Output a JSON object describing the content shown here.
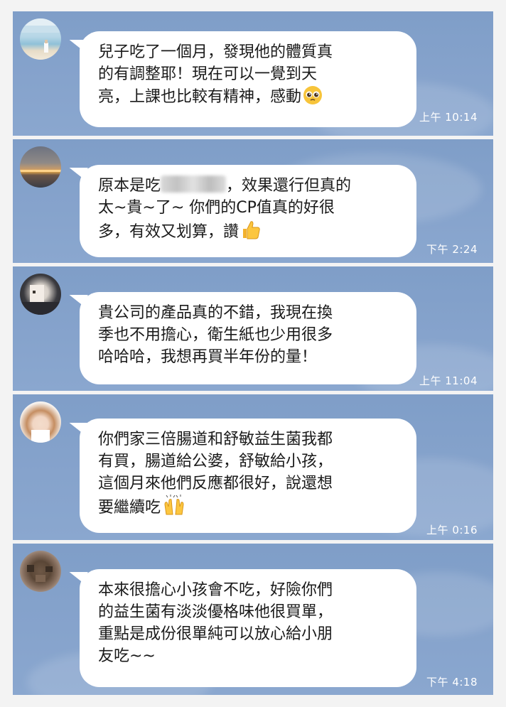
{
  "messages": [
    {
      "lines": [
        "兒子吃了一個月，發現他的體質真",
        "的有調整耶！現在可以一覺到天",
        "亮，上課也比較有精神，感動"
      ],
      "emoji": "pleading-face-icon",
      "time": "上午 10:14"
    },
    {
      "line1_before": "原本是吃",
      "line1_after": "，效果還行但真的",
      "lines_rest": [
        "太~貴~了~ 你們的CP值真的好很",
        "多，有效又划算，讚"
      ],
      "emoji": "thumbs-up-icon",
      "time": "下午 2:24"
    },
    {
      "lines": [
        "貴公司的產品真的不錯，我現在換",
        "季也不用擔心，衛生紙也少用很多",
        "哈哈哈，我想再買半年份的量！"
      ],
      "time": "上午 11:04"
    },
    {
      "lines": [
        "你們家三倍腸道和舒敏益生菌我都",
        "有買，腸道給公婆，舒敏給小孩，",
        "這個月來他們反應都很好，說還想",
        "要繼續吃"
      ],
      "emoji": "raising-hands-icon",
      "time": "上午 0:16"
    },
    {
      "lines": [
        "本來很擔心小孩會不吃，好險你們",
        "的益生菌有淡淡優格味他很買單，",
        "重點是成份很單純可以放心給小朋",
        "友吃~~"
      ],
      "time": "下午 4:18"
    }
  ],
  "colors": {
    "panel": "#86a3cc",
    "bubble": "#ffffff",
    "text": "#1a1a1a",
    "time": "#ffffff"
  }
}
